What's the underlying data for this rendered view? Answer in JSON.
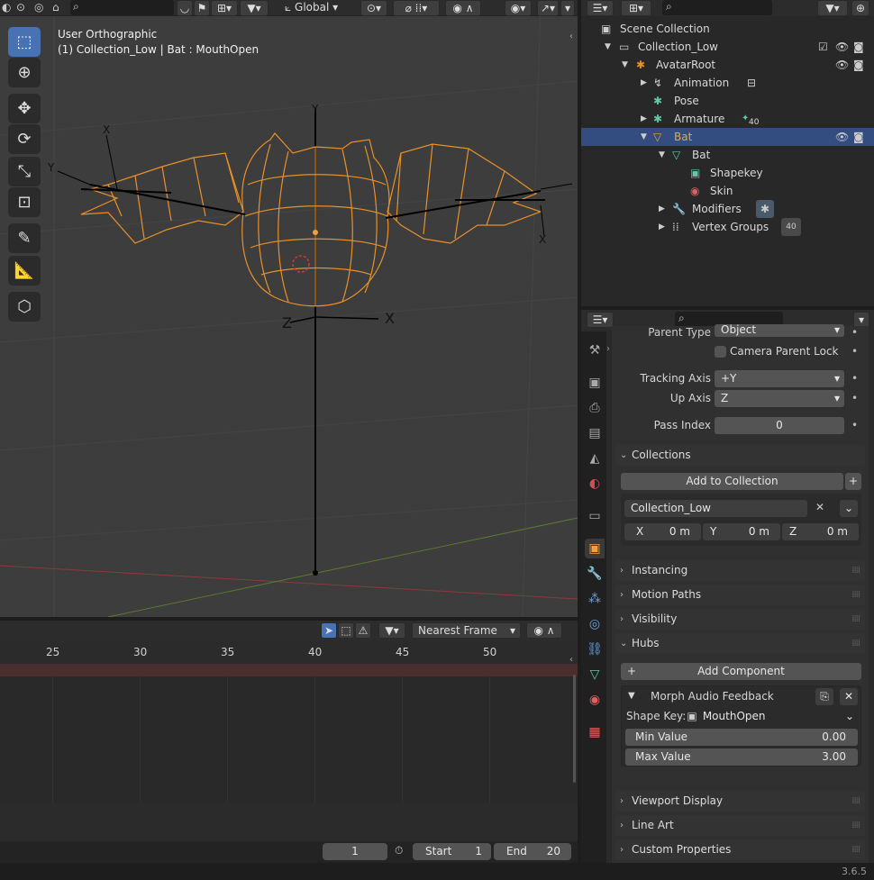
{
  "viewport": {
    "orientation_select": "Global",
    "info_line1": "User Orthographic",
    "info_line2": "(1) Collection_Low | Bat : MouthOpen",
    "axis_labels": {
      "y_top": "Y",
      "x_left": "X",
      "y_left": "Y",
      "z_bottom": "Z",
      "x_bottom": "X",
      "x_right": "X"
    }
  },
  "timeline": {
    "snap_select": "Nearest Frame",
    "ticks": [
      "25",
      "30",
      "35",
      "40",
      "45",
      "50"
    ],
    "current_frame": "1",
    "start_label": "Start",
    "start_value": "1",
    "end_label": "End",
    "end_value": "20"
  },
  "outliner": {
    "rows": [
      {
        "label": "Scene Collection"
      },
      {
        "label": "Collection_Low"
      },
      {
        "label": "AvatarRoot"
      },
      {
        "label": "Animation"
      },
      {
        "label": "Pose"
      },
      {
        "label": "Armature",
        "badge": "40"
      },
      {
        "label": "Bat"
      },
      {
        "label": "Bat"
      },
      {
        "label": "Shapekey"
      },
      {
        "label": "Skin"
      },
      {
        "label": "Modifiers"
      },
      {
        "label": "Vertex Groups",
        "badge": "40"
      }
    ]
  },
  "properties": {
    "parent_type_label": "Parent Type",
    "parent_type_value": "Object",
    "camera_parent_lock": "Camera Parent Lock",
    "tracking_axis_label": "Tracking Axis",
    "tracking_axis_value": "+Y",
    "up_axis_label": "Up Axis",
    "up_axis_value": "Z",
    "pass_index_label": "Pass Index",
    "pass_index_value": "0",
    "collections": {
      "title": "Collections",
      "add_button": "Add to Collection",
      "name": "Collection_Low",
      "x_label": "X",
      "x_value": "0 m",
      "y_label": "Y",
      "y_value": "0 m",
      "z_label": "Z",
      "z_value": "0 m"
    },
    "panels_collapsed_1": [
      "Instancing",
      "Motion Paths",
      "Visibility"
    ],
    "hubs": {
      "title": "Hubs",
      "add_component": "Add Component",
      "component_title": "Morph Audio Feedback",
      "shape_key_label": "Shape Key:",
      "shape_key_value": "MouthOpen",
      "min_label": "Min Value",
      "min_value": "0.00",
      "max_label": "Max Value",
      "max_value": "3.00"
    },
    "panels_collapsed_2": [
      "Viewport Display",
      "Line Art",
      "Custom Properties"
    ]
  },
  "status_bar": {
    "version": "3.6.5"
  },
  "colors": {
    "accent_blue": "#4772b3",
    "selection_row": "#334d80",
    "wire_orange": "#e8902a",
    "object_orange": "#f0a040"
  }
}
